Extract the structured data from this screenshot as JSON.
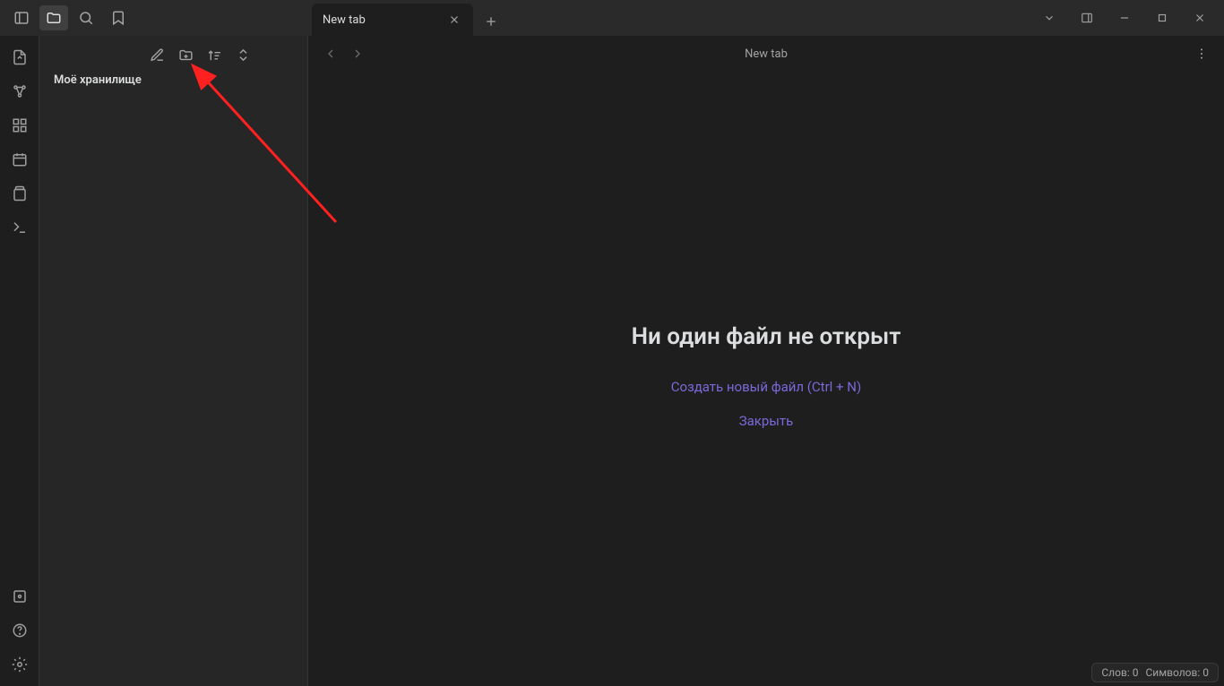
{
  "titlebar": {
    "tabs": [
      {
        "label": "New tab"
      }
    ]
  },
  "sidebar": {
    "vault_title": "Моё хранилище"
  },
  "main": {
    "header_title": "New tab",
    "empty_heading": "Ни один файл не открыт",
    "create_link": "Создать новый файл (Ctrl + N)",
    "close_link": "Закрыть"
  },
  "statusbar": {
    "words_label": "Слов:",
    "words_value": "0",
    "chars_label": "Символов:",
    "chars_value": "0"
  }
}
